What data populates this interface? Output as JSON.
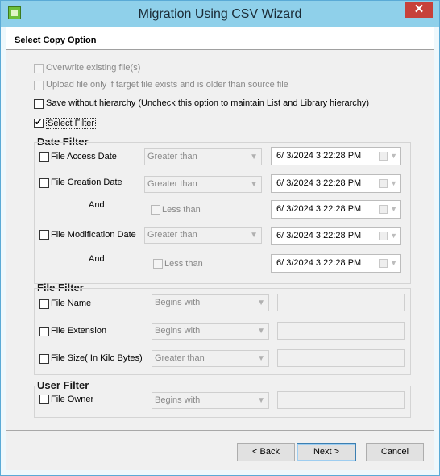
{
  "window": {
    "title": "Migration Using CSV Wizard",
    "close_glyph": "✕",
    "app_icon": "csv-app-icon"
  },
  "header": {
    "section_title": "Select Copy Option"
  },
  "options": {
    "overwrite": "Overwrite existing file(s)",
    "upload_only": "Upload file only if target file exists and is older than source file",
    "save_without_hierarchy": "Save without hierarchy (Uncheck this option to maintain List and Library hierarchy)",
    "select_filter": "Select Filter"
  },
  "date_filter": {
    "title": "Date Filter",
    "access_label": "File Access Date",
    "creation_label": "File Creation Date",
    "modification_label": "File Modification Date",
    "and_label": "And",
    "less_than_label": "Less than",
    "greater_than": "Greater than",
    "date_value": "6/  3/2024   3:22:28 PM"
  },
  "file_filter": {
    "title": "File Filter",
    "name_label": "File Name",
    "extension_label": "File Extension",
    "size_label": "File Size( In Kilo Bytes)",
    "begins_with": "Begins with",
    "greater_than": "Greater than"
  },
  "user_filter": {
    "title": "User Filter",
    "owner_label": "File Owner",
    "begins_with": "Begins with"
  },
  "buttons": {
    "back": "< Back",
    "next": "Next >",
    "cancel": "Cancel"
  },
  "colors": {
    "titlebar": "#8fd0ea",
    "close": "#c7413a",
    "accent": "#3c7fb1"
  }
}
